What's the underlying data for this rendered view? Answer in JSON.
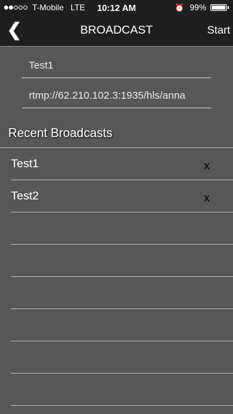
{
  "status_bar": {
    "carrier": "T-Mobile",
    "network": "LTE",
    "time": "10:12 AM",
    "battery": "99%",
    "battery_level": 0.99,
    "signal_bars": 2,
    "signal_total": 5
  },
  "nav": {
    "back_glyph": "❮",
    "title": "BROADCAST",
    "start_label": "Start"
  },
  "form": {
    "name_value": "Test1",
    "url_value": "rtmp://62.210.102.3:1935/hls/anna"
  },
  "recent": {
    "title": "Recent Broadcasts",
    "items": [
      {
        "name": "Test1",
        "delete_label": "x"
      },
      {
        "name": "Test2",
        "delete_label": "x"
      }
    ]
  }
}
